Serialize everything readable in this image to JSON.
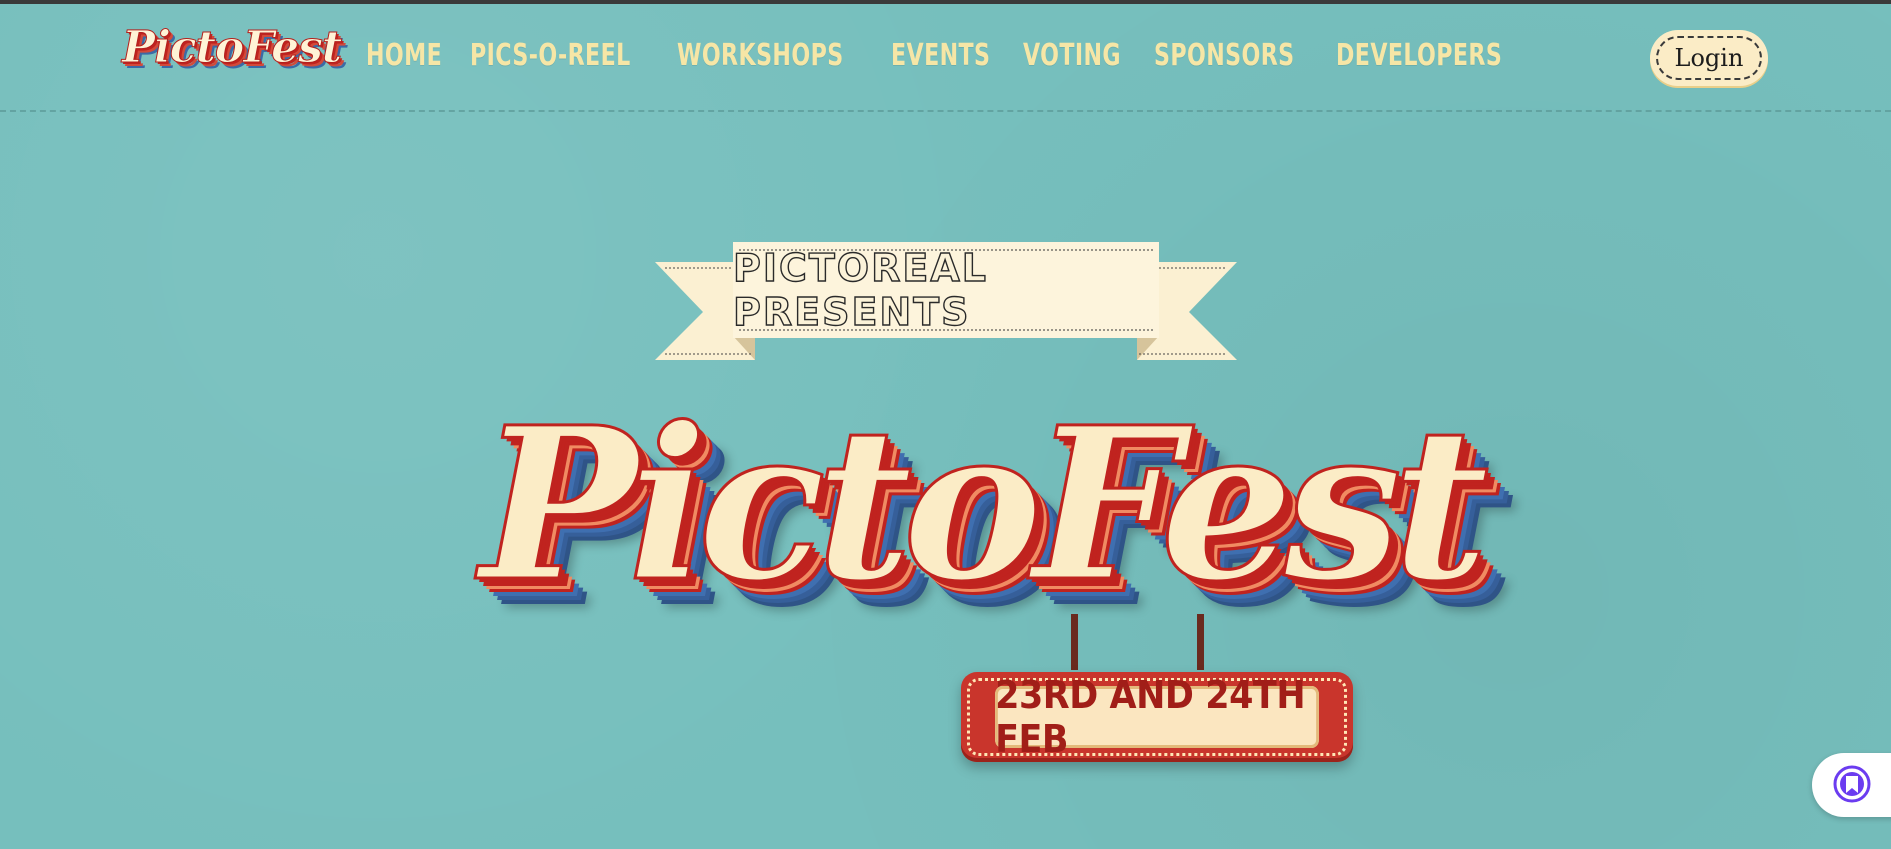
{
  "nav": {
    "brand": "PictoFest",
    "links": [
      "HOME",
      "PICS-O-REEL",
      "WORKSHOPS",
      "EVENTS",
      "VOTING",
      "SPONSORS",
      "DEVELOPERS"
    ],
    "login_label": "Login"
  },
  "hero": {
    "ribbon_text": "PICTOREAL PRESENTS",
    "logo_text": "PictoFest",
    "date_text": "23RD AND 24TH FEB"
  },
  "widget": {
    "icon": "bookmark-icon"
  },
  "colors": {
    "background": "#76bfbd",
    "nav_text": "#f6e6a6",
    "cream": "#fbecc6",
    "logo_red": "#c0231f",
    "logo_blue": "#3f6fb0",
    "widget_accent": "#6b3cf0"
  }
}
